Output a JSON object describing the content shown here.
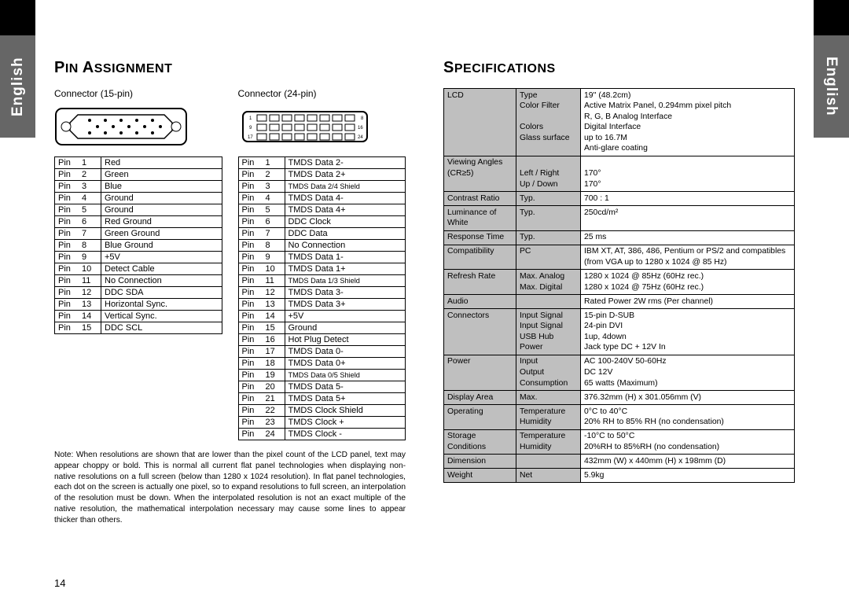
{
  "language_tab": "English",
  "left": {
    "heading": "Pin Assignment",
    "connector15_label": "Connector (15-pin)",
    "connector24_label": "Connector (24-pin)",
    "pins15": [
      {
        "n": "1",
        "label": "Red"
      },
      {
        "n": "2",
        "label": "Green"
      },
      {
        "n": "3",
        "label": "Blue"
      },
      {
        "n": "4",
        "label": "Ground"
      },
      {
        "n": "5",
        "label": "Ground"
      },
      {
        "n": "6",
        "label": "Red Ground"
      },
      {
        "n": "7",
        "label": "Green Ground"
      },
      {
        "n": "8",
        "label": "Blue Ground"
      },
      {
        "n": "9",
        "label": "+5V"
      },
      {
        "n": "10",
        "label": "Detect Cable"
      },
      {
        "n": "11",
        "label": "No Connection"
      },
      {
        "n": "12",
        "label": "DDC SDA"
      },
      {
        "n": "13",
        "label": "Horizontal Sync."
      },
      {
        "n": "14",
        "label": "Vertical Sync."
      },
      {
        "n": "15",
        "label": "DDC SCL"
      }
    ],
    "pins24": [
      {
        "n": "1",
        "label": "TMDS Data 2-"
      },
      {
        "n": "2",
        "label": "TMDS Data 2+"
      },
      {
        "n": "3",
        "label": "TMDS Data 2/4 Shield",
        "tiny": true
      },
      {
        "n": "4",
        "label": "TMDS Data 4-"
      },
      {
        "n": "5",
        "label": "TMDS Data 4+"
      },
      {
        "n": "6",
        "label": "DDC Clock"
      },
      {
        "n": "7",
        "label": "DDC Data"
      },
      {
        "n": "8",
        "label": "No Connection"
      },
      {
        "n": "9",
        "label": "TMDS Data 1-"
      },
      {
        "n": "10",
        "label": "TMDS Data 1+"
      },
      {
        "n": "11",
        "label": "TMDS Data 1/3 Shield",
        "tiny": true
      },
      {
        "n": "12",
        "label": "TMDS Data 3-"
      },
      {
        "n": "13",
        "label": "TMDS Data 3+"
      },
      {
        "n": "14",
        "label": "+5V"
      },
      {
        "n": "15",
        "label": "Ground"
      },
      {
        "n": "16",
        "label": "Hot Plug Detect"
      },
      {
        "n": "17",
        "label": "TMDS Data 0-"
      },
      {
        "n": "18",
        "label": "TMDS Data 0+"
      },
      {
        "n": "19",
        "label": "TMDS Data 0/5 Shield",
        "tiny": true
      },
      {
        "n": "20",
        "label": "TMDS Data 5-"
      },
      {
        "n": "21",
        "label": "TMDS Data 5+"
      },
      {
        "n": "22",
        "label": "TMDS Clock Shield"
      },
      {
        "n": "23",
        "label": "TMDS Clock +"
      },
      {
        "n": "24",
        "label": "TMDS Clock -"
      }
    ],
    "note": "Note: When resolutions are shown that are lower than the pixel count of the LCD panel, text may appear choppy or bold. This is normal all current flat panel technologies when displaying non-native resolutions on a full screen (below than 1280 x 1024 resolution). In flat panel technologies, each dot on the screen is actually one pixel, so to expand resolutions to full screen, an interpolation of the resolution must be down. When the interpolated resolution is not an exact multiple of the native resolution, the mathematical interpolation necessary may cause some lines to appear thicker than others.",
    "page_number": "14",
    "pin_word": "Pin"
  },
  "right": {
    "heading": "Specifications",
    "rows": [
      {
        "lbl": "LCD",
        "sub": "Type\nColor Filter\n\nColors\nGlass surface",
        "val": "19'' (48.2cm)\nActive Matrix Panel, 0.294mm pixel pitch\nR, G, B Analog Interface\nDigital Interface\nup to 16.7M\nAnti-glare coating"
      },
      {
        "lbl": "Viewing Angles (CR≥5)",
        "sub": "\nLeft / Right\nUp / Down",
        "val": "\n170°\n170°"
      },
      {
        "lbl": "Contrast Ratio",
        "sub": "Typ.",
        "val": "700 : 1"
      },
      {
        "lbl": "Luminance of White",
        "sub": "Typ.",
        "val": "250cd/m²"
      },
      {
        "lbl": "Response Time",
        "sub": "Typ.",
        "val": "25 ms"
      },
      {
        "lbl": "Compatibility",
        "sub": "PC",
        "val": "IBM XT, AT, 386, 486, Pentium or PS/2 and compatibles (from VGA up to 1280 x 1024 @ 85 Hz)"
      },
      {
        "lbl": "Refresh Rate",
        "sub": "Max. Analog\nMax. Digital",
        "val": "1280 x 1024 @ 85Hz (60Hz rec.)\n1280 x 1024 @ 75Hz (60Hz rec.)"
      },
      {
        "lbl": "Audio",
        "sub": "",
        "val": "Rated Power 2W rms (Per channel)"
      },
      {
        "lbl": "Connectors",
        "sub": "Input Signal\nInput Signal\nUSB Hub\nPower",
        "val": "15-pin D-SUB\n24-pin DVI\n1up, 4down\nJack type DC + 12V In"
      },
      {
        "lbl": "Power",
        "sub": "Input\nOutput\nConsumption",
        "val": "AC   100-240V   50-60Hz\nDC   12V\n65 watts (Maximum)"
      },
      {
        "lbl": "Display Area",
        "sub": "Max.",
        "val": "376.32mm (H) x 301.056mm (V)"
      },
      {
        "lbl": "Operating",
        "sub": "Temperature\nHumidity",
        "val": "0°C to 40°C\n20% RH to 85% RH (no condensation)"
      },
      {
        "lbl": "Storage Conditions",
        "sub": "Temperature\nHumidity",
        "val": "-10°C to 50°C\n20%RH to 85%RH (no condensation)"
      },
      {
        "lbl": "Dimension",
        "sub": "",
        "val": "432mm (W) x 440mm (H) x 198mm (D)"
      },
      {
        "lbl": "Weight",
        "sub": "Net",
        "val": "5.9kg"
      }
    ]
  }
}
